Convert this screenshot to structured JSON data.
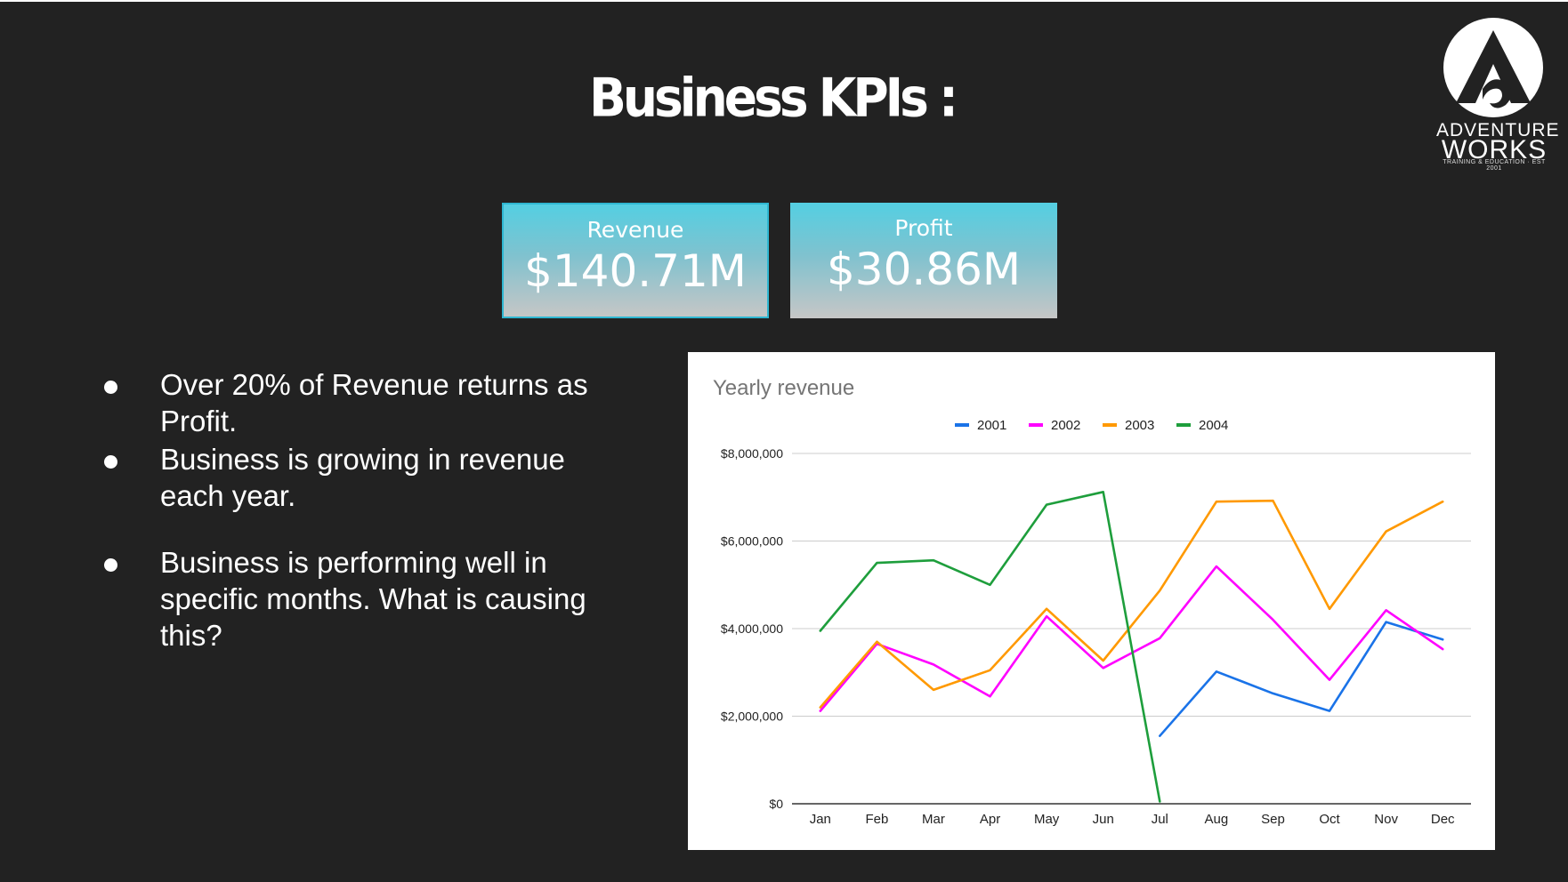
{
  "slide": {
    "title": "Business KPIs :",
    "logo": {
      "line1": "ADVENTURE",
      "line2": "WORKS",
      "tagline": "TRAINING & EDUCATION · EST 2001"
    },
    "kpis": [
      {
        "label": "Revenue",
        "value": "$140.71M"
      },
      {
        "label": "Profit",
        "value": "$30.86M"
      }
    ],
    "bullets": [
      "Over 20% of Revenue returns as Profit.",
      "Business is growing in revenue each year.",
      "Business is performing well in specific months. What is causing this?"
    ]
  },
  "chart_data": {
    "type": "line",
    "title": "Yearly revenue",
    "categories": [
      "Jan",
      "Feb",
      "Mar",
      "Apr",
      "May",
      "Jun",
      "Jul",
      "Aug",
      "Sep",
      "Oct",
      "Nov",
      "Dec"
    ],
    "ylim": [
      0,
      8000000
    ],
    "yticks": [
      "$0",
      "$2,000,000",
      "$4,000,000",
      "$6,000,000",
      "$8,000,000"
    ],
    "legend_position": "top",
    "grid": true,
    "series": [
      {
        "name": "2001",
        "color": "#1a73e8",
        "values": [
          null,
          null,
          null,
          null,
          null,
          null,
          1550000,
          3020000,
          2520000,
          2120000,
          4150000,
          3750000
        ]
      },
      {
        "name": "2002",
        "color": "#ff00ff",
        "values": [
          2120000,
          3650000,
          3180000,
          2450000,
          4280000,
          3100000,
          3780000,
          5420000,
          4200000,
          2830000,
          4420000,
          3530000
        ]
      },
      {
        "name": "2003",
        "color": "#ff9900",
        "values": [
          2200000,
          3700000,
          2600000,
          3050000,
          4450000,
          3270000,
          4870000,
          6900000,
          6920000,
          4450000,
          6220000,
          6900000
        ]
      },
      {
        "name": "2004",
        "color": "#1e9e3c",
        "values": [
          3950000,
          5500000,
          5560000,
          5000000,
          6830000,
          7120000,
          50000,
          null,
          null,
          null,
          null,
          null
        ]
      }
    ]
  }
}
